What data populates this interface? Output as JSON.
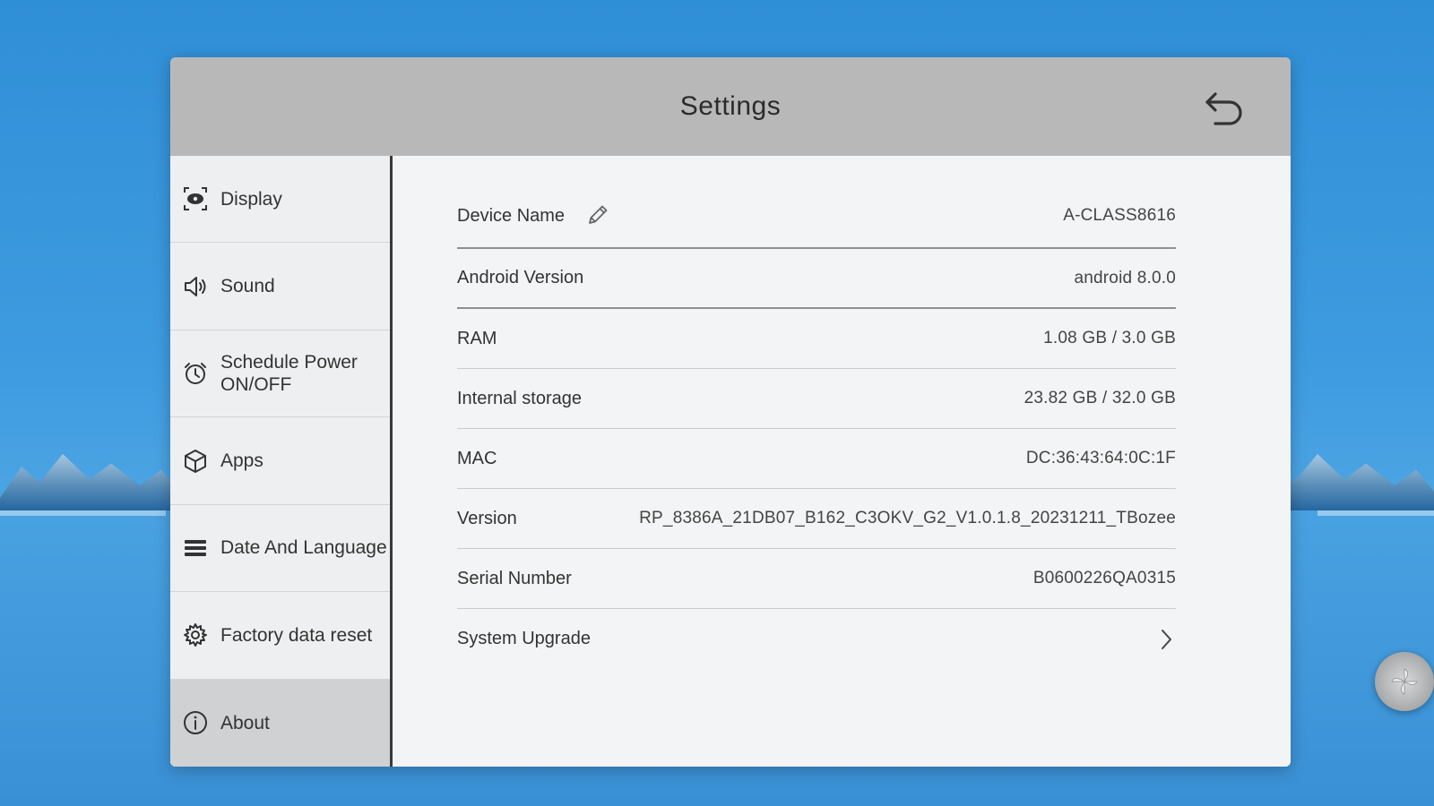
{
  "window": {
    "title": "Settings"
  },
  "sidebar": {
    "items": [
      {
        "label": "Display",
        "icon": "eye-display-icon"
      },
      {
        "label": "Sound",
        "icon": "speaker-icon"
      },
      {
        "label": "Schedule Power ON/OFF",
        "icon": "alarm-clock-icon"
      },
      {
        "label": "Apps",
        "icon": "cube-icon"
      },
      {
        "label": "Date And Language",
        "icon": "list-icon"
      },
      {
        "label": "Factory data reset",
        "icon": "gear-icon"
      },
      {
        "label": "About",
        "icon": "info-icon",
        "active": true
      }
    ]
  },
  "about": {
    "rows": [
      {
        "label": "Device Name",
        "value": "A-CLASS8616"
      },
      {
        "label": "Android Version",
        "value": "android 8.0.0"
      },
      {
        "label": "RAM",
        "value": "1.08 GB / 3.0 GB"
      },
      {
        "label": "Internal storage",
        "value": "23.82 GB / 32.0 GB"
      },
      {
        "label": "MAC",
        "value": "DC:36:43:64:0C:1F"
      },
      {
        "label": "Version",
        "value": "RP_8386A_21DB07_B162_C3OKV_G2_V1.0.1.8_20231211_TBozee"
      },
      {
        "label": "Serial Number",
        "value": "B0600226QA0315"
      }
    ],
    "upgrade_label": "System Upgrade"
  }
}
